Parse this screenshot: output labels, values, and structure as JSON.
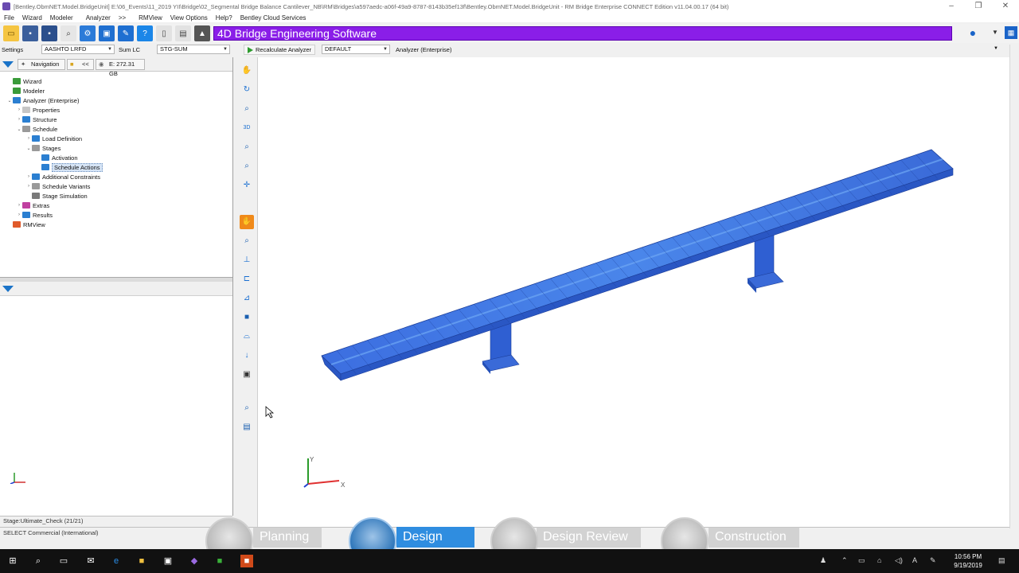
{
  "window": {
    "title": "[Bentley.ObmNET.Model.BridgeUnit] E:\\06_Events\\11_2019 YII\\Bridge\\02_Segmental Bridge Balance Cantilever_NB\\RM\\Bridges\\a597aedc-a06f-49a9-8787-8143b35ef13f\\Bentley.ObmNET.Model.BridgeUnit - RM Bridge Enterprise CONNECT Edition v11.04.00.17 (64 bit)",
    "controls": [
      "–",
      "❐",
      "✕"
    ]
  },
  "menu": [
    "File",
    "Wizard",
    "Modeler",
    "Analyzer",
    ">>",
    "RMView",
    "View Options",
    "Help?",
    "Bentley Cloud Services"
  ],
  "banner": "4D Bridge Engineering Software",
  "settings": {
    "label": "Settings",
    "code": "AASHTO LRFD",
    "sum_label": "Sum LC",
    "stage": "STG-SUM"
  },
  "analyzer_bar": {
    "recalc": "Recalculate Analyzer",
    "default": "DEFAULT",
    "mode": "Analyzer (Enterprise)"
  },
  "nav": {
    "tab": "Navigation",
    "back": "<<",
    "disk": "E: 272.31 GB"
  },
  "tree": [
    {
      "label": "Wizard",
      "indent": 0,
      "exp": "",
      "color": "#3a9b3a"
    },
    {
      "label": "Modeler",
      "indent": 0,
      "exp": "",
      "color": "#3a9b3a"
    },
    {
      "label": "Analyzer (Enterprise)",
      "indent": 0,
      "exp": "⌄",
      "color": "#2b7fd1"
    },
    {
      "label": "Properties",
      "indent": 1,
      "exp": "›",
      "color": "#c6c6c6"
    },
    {
      "label": "Structure",
      "indent": 1,
      "exp": "›",
      "color": "#2b7fd1"
    },
    {
      "label": "Schedule",
      "indent": 1,
      "exp": "⌄",
      "color": "#9a9a9a"
    },
    {
      "label": "Load Definition",
      "indent": 2,
      "exp": "›",
      "color": "#2b7fd1"
    },
    {
      "label": "Stages",
      "indent": 2,
      "exp": "⌄",
      "color": "#9a9a9a"
    },
    {
      "label": "Activation",
      "indent": 3,
      "exp": "",
      "color": "#2b7fd1"
    },
    {
      "label": "Schedule Actions",
      "indent": 3,
      "exp": "",
      "color": "#2b7fd1",
      "selected": true
    },
    {
      "label": "Additional Constraints",
      "indent": 2,
      "exp": "›",
      "color": "#2b7fd1"
    },
    {
      "label": "Schedule Variants",
      "indent": 2,
      "exp": "›",
      "color": "#9a9a9a"
    },
    {
      "label": "Stage Simulation",
      "indent": 2,
      "exp": "",
      "color": "#7a7a7a"
    },
    {
      "label": "Extras",
      "indent": 1,
      "exp": "›",
      "color": "#c040a0"
    },
    {
      "label": "Results",
      "indent": 1,
      "exp": "›",
      "color": "#2b7fd1"
    },
    {
      "label": "RMView",
      "indent": 0,
      "exp": "",
      "color": "#e05a2a"
    }
  ],
  "status": {
    "stage_check": "Stage:Ultimate_Check   (21/21)",
    "select": "SELECT Commercial (International)"
  },
  "viewport_axis": {
    "x": "X",
    "y": "Y"
  },
  "phases": [
    {
      "label": "Planning",
      "active": false
    },
    {
      "label": "Design",
      "active": true
    },
    {
      "label": "Design Review",
      "active": false
    },
    {
      "label": "Construction",
      "active": false
    }
  ],
  "taskbar": {
    "time": "10:56 PM",
    "date": "9/19/2019",
    "lang": "A"
  },
  "colors": {
    "banner": "#8a1ee8",
    "bridge": "#2f63d8",
    "phase_active": "#2f8de0"
  }
}
